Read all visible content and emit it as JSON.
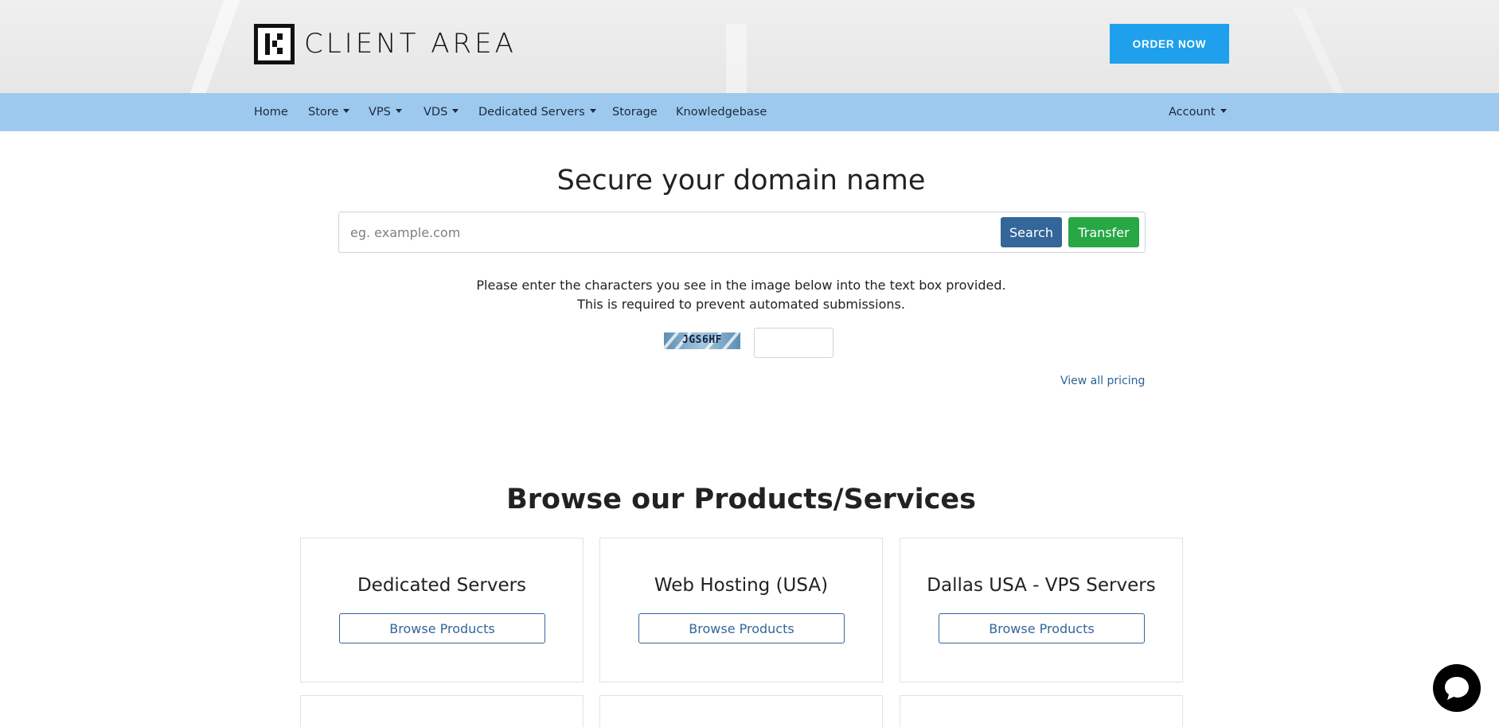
{
  "header": {
    "logo_text": "CLIENT AREA",
    "order_button": "ORDER NOW",
    "accent_color": "#1ea0ec"
  },
  "nav": {
    "items": [
      {
        "label": "Home",
        "dropdown": false
      },
      {
        "label": "Store",
        "dropdown": true
      },
      {
        "label": "VPS",
        "dropdown": true
      },
      {
        "label": "VDS",
        "dropdown": true
      },
      {
        "label": "Dedicated Servers",
        "dropdown": true
      },
      {
        "label": "Storage",
        "dropdown": false
      },
      {
        "label": "Knowledgebase",
        "dropdown": false
      }
    ],
    "account": {
      "label": "Account",
      "dropdown": true
    },
    "bar_color": "#9ec9ef"
  },
  "domain": {
    "title": "Secure your domain name",
    "placeholder": "eg. example.com",
    "search_label": "Search",
    "transfer_label": "Transfer",
    "captcha_instructions": "Please enter the characters you see in the image below into the text box provided. This is required to prevent automated submissions.",
    "captcha_code": "JGS6HF",
    "captcha_value": "",
    "view_pricing": "View all pricing"
  },
  "browse": {
    "title": "Browse our Products/Services",
    "cards": [
      {
        "title": "Dedicated Servers",
        "button": "Browse Products"
      },
      {
        "title": "Web Hosting (USA)",
        "button": "Browse Products"
      },
      {
        "title": "Dallas USA - VPS Servers",
        "button": "Browse Products"
      }
    ]
  },
  "chat": {
    "icon": "chat-bubble-icon"
  }
}
